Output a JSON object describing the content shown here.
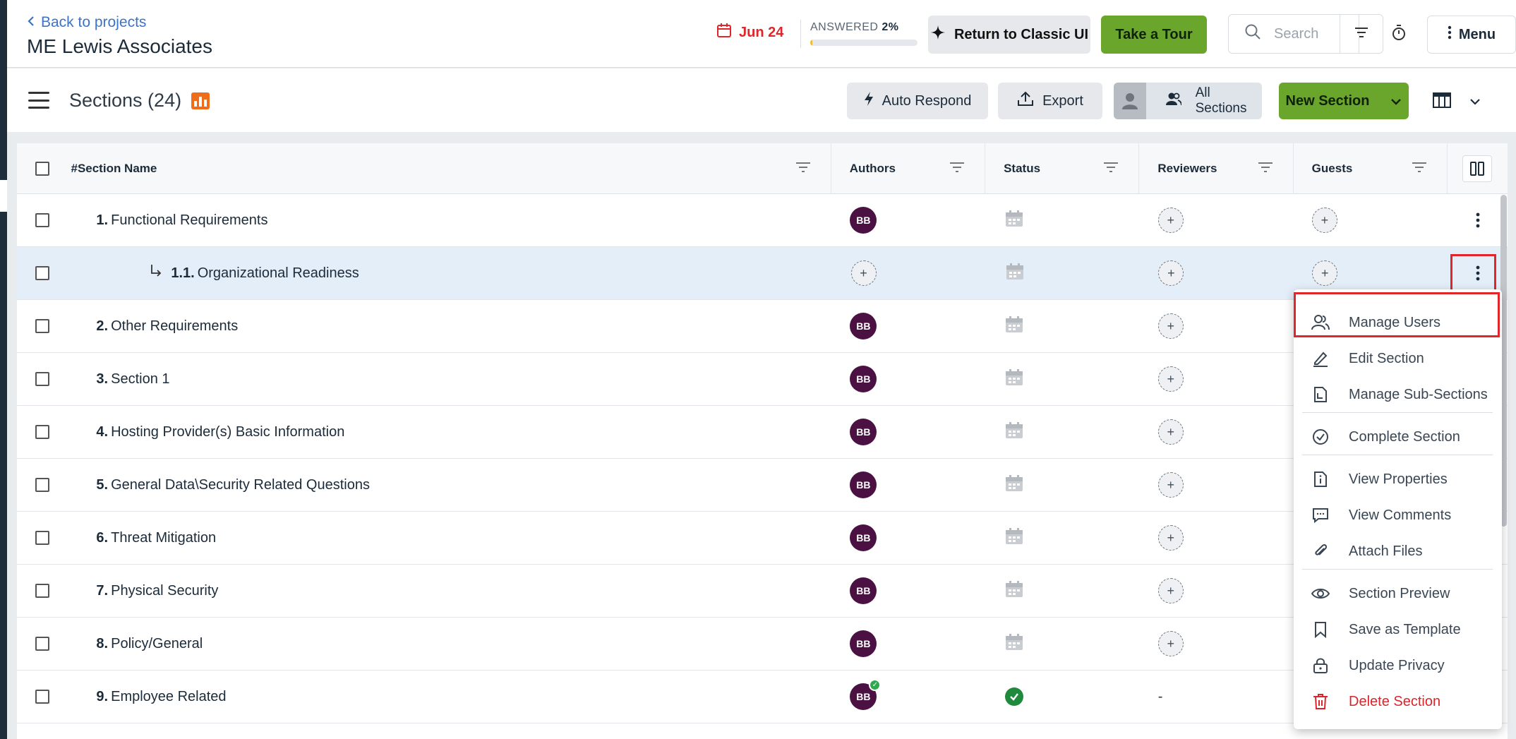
{
  "header": {
    "back_label": "Back to projects",
    "project_title": "ME Lewis Associates",
    "due_date": "Jun 24",
    "answered_label": "ANSWERED",
    "answered_pct": "2%",
    "answered_fraction": 0.02,
    "classic_label": "Return to Classic UI",
    "tour_label": "Take a Tour",
    "search_placeholder": "Search",
    "menu_label": "Menu"
  },
  "toolbar": {
    "title": "Sections (24)",
    "auto_respond": "Auto Respond",
    "export": "Export",
    "all_sections": "All Sections",
    "new_section": "New Section"
  },
  "table": {
    "columns": {
      "hash": "#",
      "name": "Section Name",
      "authors": "Authors",
      "status": "Status",
      "reviewers": "Reviewers",
      "guests": "Guests"
    },
    "rows": [
      {
        "num": "1.",
        "name": "Functional Requirements",
        "author": "BB",
        "status": "calendar",
        "reviewer": "+",
        "guest": "+"
      },
      {
        "num": "1.1.",
        "name": "Organizational Readiness",
        "author": "+",
        "status": "calendar",
        "reviewer": "+",
        "guest": "+"
      },
      {
        "num": "2.",
        "name": "Other Requirements",
        "author": "BB",
        "status": "calendar",
        "reviewer": "+"
      },
      {
        "num": "3.",
        "name": "Section 1",
        "author": "BB",
        "status": "calendar",
        "reviewer": "+"
      },
      {
        "num": "4.",
        "name": "Hosting Provider(s) Basic Information",
        "author": "BB",
        "status": "calendar",
        "reviewer": "+"
      },
      {
        "num": "5.",
        "name": "General Data\\Security Related Questions",
        "author": "BB",
        "status": "calendar",
        "reviewer": "+"
      },
      {
        "num": "6.",
        "name": "Threat Mitigation",
        "author": "BB",
        "status": "calendar",
        "reviewer": "+"
      },
      {
        "num": "7.",
        "name": "Physical Security",
        "author": "BB",
        "status": "calendar",
        "reviewer": "+"
      },
      {
        "num": "8.",
        "name": "Policy/General",
        "author": "BB",
        "status": "calendar",
        "reviewer": "+"
      },
      {
        "num": "9.",
        "name": "Employee Related",
        "author": "BB",
        "status": "complete",
        "reviewer": "-"
      }
    ]
  },
  "context_menu": {
    "items": [
      {
        "label": "Manage Users",
        "icon": "users-icon"
      },
      {
        "label": "Edit Section",
        "icon": "pencil-icon"
      },
      {
        "label": "Manage Sub-Sections",
        "icon": "document-icon"
      },
      {
        "label": "Complete Section",
        "icon": "check-circle-icon"
      },
      {
        "label": "View Properties",
        "icon": "info-doc-icon"
      },
      {
        "label": "View Comments",
        "icon": "comment-icon"
      },
      {
        "label": "Attach Files",
        "icon": "paperclip-icon"
      },
      {
        "label": "Section Preview",
        "icon": "eye-icon"
      },
      {
        "label": "Save as Template",
        "icon": "bookmark-icon"
      },
      {
        "label": "Update Privacy",
        "icon": "lock-icon"
      },
      {
        "label": "Delete Section",
        "icon": "trash-icon"
      }
    ]
  },
  "colors": {
    "accent_green": "#6aa62b",
    "due_red": "#e0262b",
    "avatar_purple": "#4a1142",
    "selected_row": "#e3eef9"
  }
}
